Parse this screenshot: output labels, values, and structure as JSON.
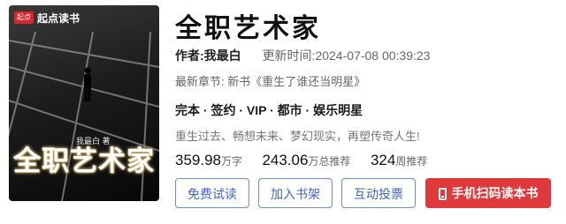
{
  "cover": {
    "badge": "起点",
    "brand": "起点读书",
    "author_line": "我最白 著",
    "title": "全职艺术家"
  },
  "book": {
    "title": "全职艺术家",
    "author": "作者:我最白",
    "updated": "更新时间:2024-07-08 00:39:23",
    "latest_chapter": "最新章节: 新书《重生了谁还当明星》",
    "tags": "完本 · 签约 · VIP · 都市 · 娱乐明星",
    "intro": "重生过去、畅想未来、梦幻现实，再塑传奇人生!"
  },
  "stats": [
    {
      "value": "359.98",
      "unit": "万字"
    },
    {
      "value": "243.06",
      "unit": "万总推荐"
    },
    {
      "value": "324",
      "unit": "周推荐"
    }
  ],
  "buttons": {
    "free_read": "免费试读",
    "add_shelf": "加入书架",
    "vote": "互动投票",
    "scan_phone": "手机扫码读本书"
  },
  "colors": {
    "accent_blue": "#4066c1",
    "primary_red": "#e0393c"
  },
  "icons": {
    "scan_button": "phone-icon"
  }
}
